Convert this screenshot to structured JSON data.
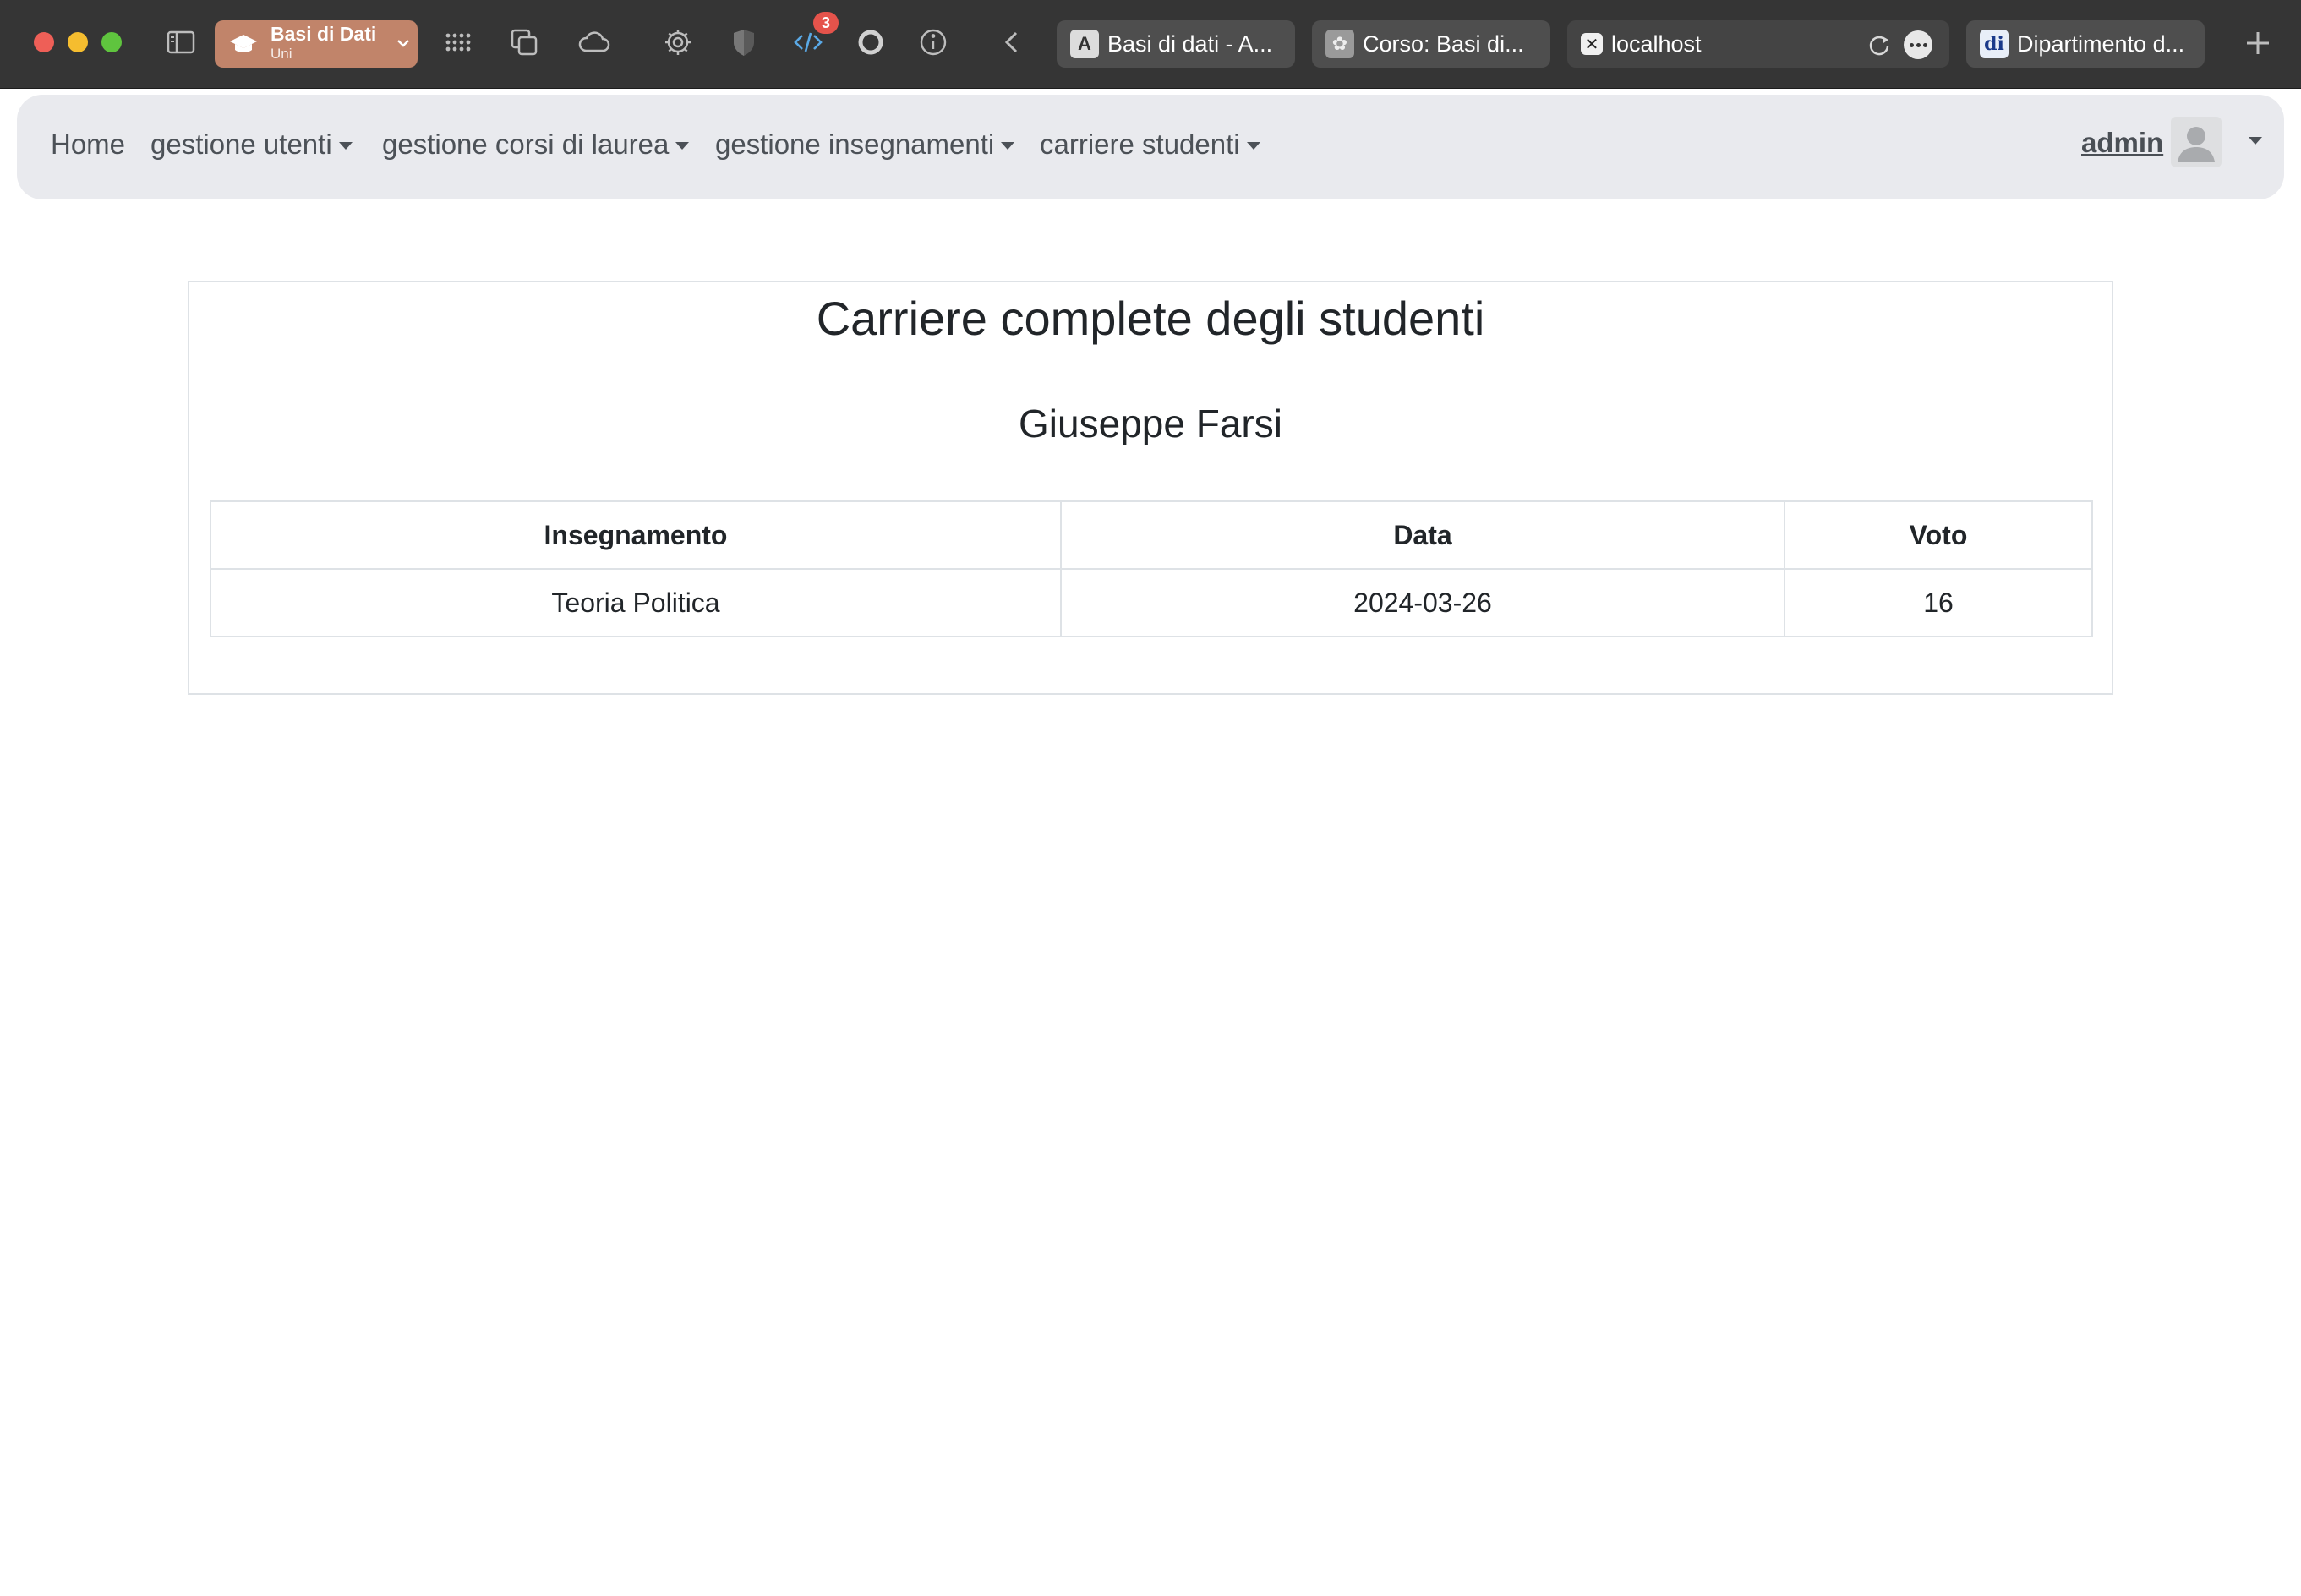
{
  "browser": {
    "tab_group": {
      "title": "Basi di Dati",
      "subtitle": "Uni"
    },
    "extension_badge": "3",
    "tabs": [
      {
        "title": "Basi di dati - A...",
        "favicon_glyph": "A"
      },
      {
        "title": "Corso: Basi di...",
        "favicon_glyph": "✿"
      },
      {
        "title": "localhost",
        "favicon_glyph": "✕"
      },
      {
        "title": "Dipartimento d...",
        "favicon_glyph": "di"
      }
    ]
  },
  "navbar": {
    "items": [
      {
        "label": "Home"
      },
      {
        "label": "gestione utenti"
      },
      {
        "label": "gestione corsi di laurea"
      },
      {
        "label": "gestione insegnamenti"
      },
      {
        "label": "carriere studenti"
      }
    ],
    "user": "admin"
  },
  "main": {
    "title": "Carriere complete degli studenti",
    "student": "Giuseppe Farsi",
    "table": {
      "headers": [
        "Insegnamento",
        "Data",
        "Voto"
      ],
      "rows": [
        [
          "Teoria Politica",
          "2024-03-26",
          "16"
        ]
      ]
    }
  },
  "colors": {
    "tab_group": "#c1846a",
    "navbar_bg": "#e9eaee",
    "text": "#212529",
    "table_border": "#dee2e6"
  }
}
